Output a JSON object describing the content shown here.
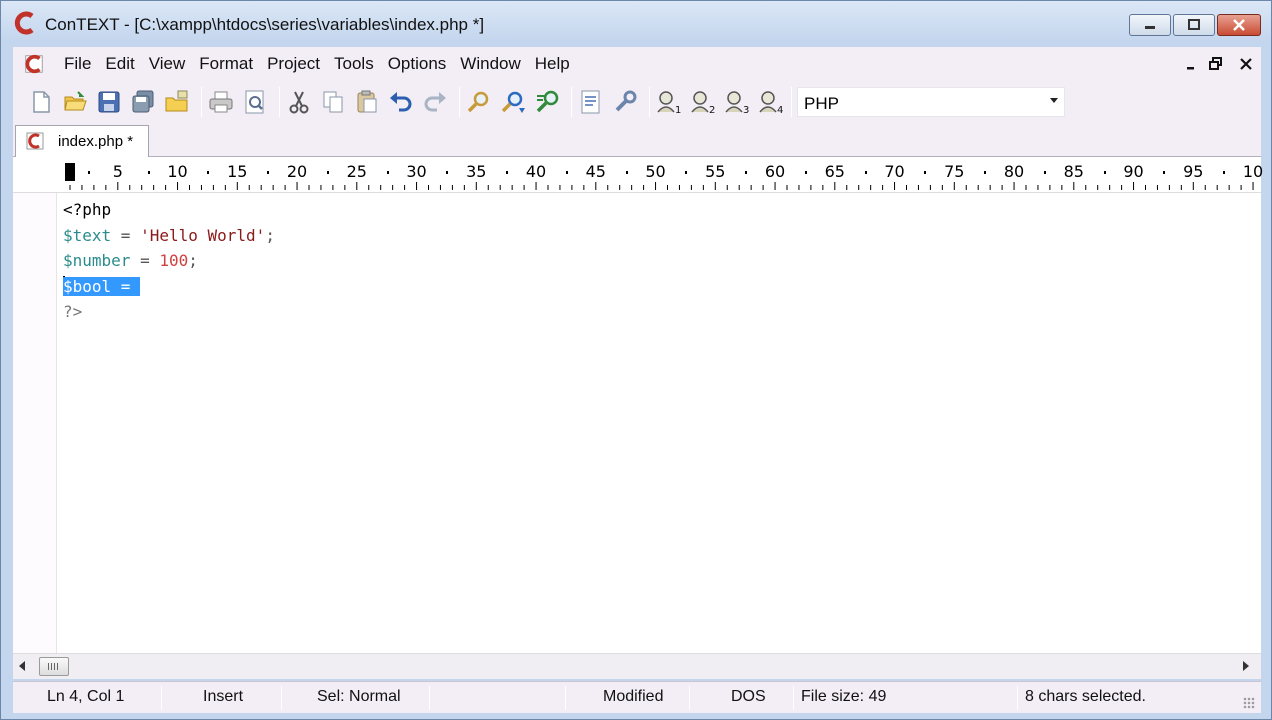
{
  "window": {
    "title": "ConTEXT - [C:\\xampp\\htdocs\\series\\variables\\index.php *]"
  },
  "menu": {
    "items": [
      "File",
      "Edit",
      "View",
      "Format",
      "Project",
      "Tools",
      "Options",
      "Window",
      "Help"
    ]
  },
  "toolbar": {
    "buttons": [
      "new-file-icon",
      "open-folder-icon",
      "save-icon",
      "save-all-icon",
      "open-project-icon",
      "print-icon",
      "print-preview-icon",
      "cut-icon",
      "copy-icon",
      "paste-icon",
      "undo-icon",
      "redo-icon",
      "find-icon",
      "find-next-icon",
      "replace-icon",
      "export-icon",
      "settings-icon",
      "user-command-1-icon",
      "user-command-2-icon",
      "user-command-3-icon",
      "user-command-4-icon"
    ],
    "user_command_numbers": [
      "1",
      "2",
      "3",
      "4"
    ],
    "language": "PHP"
  },
  "tab": {
    "label": "index.php *"
  },
  "ruler": {
    "labels": [
      "5",
      "10",
      "15",
      "20",
      "25",
      "30",
      "35",
      "40",
      "45",
      "50",
      "55",
      "60",
      "65",
      "70",
      "75",
      "80",
      "85",
      "90",
      "95",
      "10"
    ]
  },
  "editor": {
    "line1": "<?php",
    "line2_var": "$text",
    "line2_op": " = ",
    "line2_str": "'Hello World'",
    "line2_end": ";",
    "line3_var": "$number",
    "line3_op": " = ",
    "line3_num": "100",
    "line3_end": ";",
    "line4_selected": "$bool = ",
    "line5": "?>"
  },
  "status": {
    "position": "Ln 4, Col 1",
    "mode": "Insert",
    "selection_mode": "Sel: Normal",
    "modified": "Modified",
    "line_endings": "DOS",
    "file_size": "File size: 49",
    "selection_info": "8 chars selected."
  },
  "colors": {
    "selection": "#3399ff",
    "variable": "#2a8c8c",
    "string": "#8b1a1a",
    "number": "#d04040",
    "logo_red": "#c0322a"
  }
}
